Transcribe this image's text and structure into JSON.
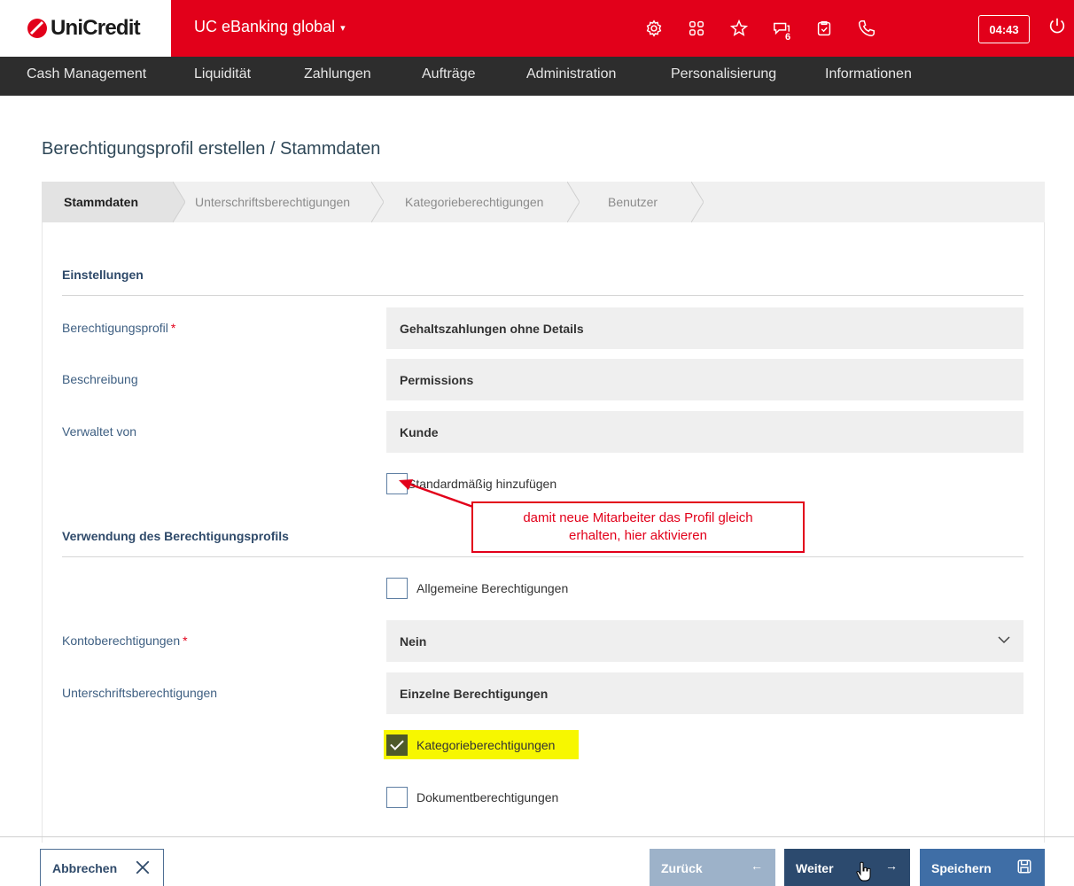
{
  "brand": {
    "name": "UniCredit",
    "color": "#e2001a"
  },
  "header": {
    "app_title": "UC eBanking global",
    "message_badge": "6",
    "session_timer": "04:43",
    "icons": [
      "gear-icon",
      "grid-icon",
      "star-icon",
      "chat-icon",
      "clipboard-check-icon",
      "phone-icon",
      "power-icon"
    ]
  },
  "nav": {
    "items": [
      "Cash Management",
      "Liquidität",
      "Zahlungen",
      "Aufträge",
      "Administration",
      "Personalisierung",
      "Informationen"
    ]
  },
  "page": {
    "title": "Berechtigungsprofil erstellen / Stammdaten"
  },
  "steps": [
    "Stammdaten",
    "Unterschriftsberechtigungen",
    "Kategorieberechtigungen",
    "Benutzer"
  ],
  "active_step": "Stammdaten",
  "settings": {
    "section_title": "Einstellungen",
    "profile_label": "Berechtigungsprofil",
    "profile_value": "Gehaltszahlungen ohne Details",
    "description_label": "Beschreibung",
    "description_value": "Permissions",
    "managed_by_label": "Verwaltet von",
    "managed_by_value": "Kunde",
    "default_add_label": "Standardmäßig hinzufügen",
    "default_add_checked": false,
    "required_mark": "*"
  },
  "callout": {
    "text_line1": "damit neue Mitarbeiter das Profil gleich",
    "text_line2": "erhalten, hier aktivieren",
    "color": "#e2001a"
  },
  "usage": {
    "section_title": "Verwendung des Berechtigungsprofils",
    "general_label": "Allgemeine Berechtigungen",
    "general_checked": false,
    "account_label": "Kontoberechtigungen",
    "account_value": "Nein",
    "signature_label": "Unterschriftsberechtigungen",
    "signature_value": "Einzelne Berechtigungen",
    "category_label": "Kategorieberechtigungen",
    "category_checked": true,
    "document_label": "Dokumentberechtigungen",
    "document_checked": false
  },
  "footer": {
    "cancel_label": "Abbrechen",
    "back_label": "Zurück",
    "next_label": "Weiter",
    "save_label": "Speichern"
  }
}
